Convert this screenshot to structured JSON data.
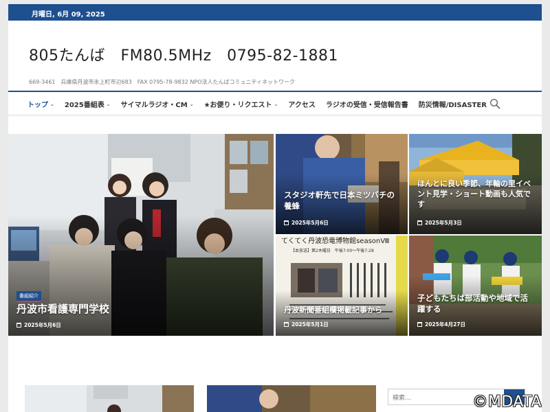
{
  "topbar": {
    "date": "月曜日, 6月 09, 2025"
  },
  "site": {
    "title": "805たんば　FM80.5MHz　0795-82-1881",
    "description": "669-3461　兵庫県丹波市氷上町市辺683　FAX 0795-78-9832 NPO法人たんばコミュニティネットワーク"
  },
  "nav": {
    "items": [
      {
        "label": "トップ",
        "has_dropdown": true,
        "active": true
      },
      {
        "label": "2025番組表",
        "has_dropdown": true
      },
      {
        "label": "サイマルラジオ・CM",
        "has_dropdown": true
      },
      {
        "label": "★お便り・リクエスト",
        "has_dropdown": true
      },
      {
        "label": "アクセス",
        "has_dropdown": false
      },
      {
        "label": "ラジオの受信・受信報告書",
        "has_dropdown": false
      },
      {
        "label": "防災情報/DISASTER",
        "has_dropdown": false
      }
    ],
    "search_icon": "search-icon"
  },
  "featured": {
    "main": {
      "badge": "番組紹介",
      "title": "丹波市看護専門学校",
      "date": "2025年5月6日"
    },
    "tiles": [
      {
        "title": "スタジオ軒先で日本ミツバチの養蜂",
        "date": "2025年5月6日"
      },
      {
        "title": "ほんとに良い季節、年輪の里イベント見学・ショート動画も人気です",
        "date": "2025年5月3日"
      },
      {
        "title": "丹波新聞番組欄掲載記事から",
        "date": "2025年5月1日",
        "poster_text": "てくてく丹波恐竜博物館seasonⅧ",
        "poster_sub": "【本放送】第2木曜日　午後7:00〜午後7:28"
      },
      {
        "title": "子どもたちは部活動や地域で活躍する",
        "date": "2025年4月27日"
      }
    ]
  },
  "sidebar": {
    "search_placeholder": "検索…"
  },
  "watermark": "©MDATA",
  "colors": {
    "brand": "#1e4f8f",
    "accent_red": "#e03b2f"
  }
}
